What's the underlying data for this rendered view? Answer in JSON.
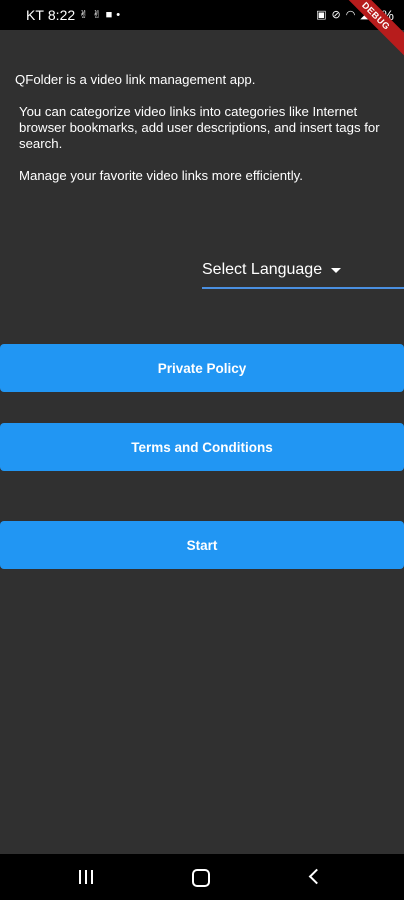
{
  "status_bar": {
    "carrier": "KT",
    "time": "8:22",
    "battery": "9%"
  },
  "debug_banner": "DEBUG",
  "intro": {
    "line1": "QFolder is a video link management app.",
    "line2": "You can categorize video links into categories like Internet browser bookmarks, add user descriptions, and insert tags for search.",
    "line3": "Manage your favorite video links more efficiently."
  },
  "language_dropdown": {
    "label": "Select Language"
  },
  "buttons": {
    "policy": "Private Policy",
    "terms": "Terms and Conditions",
    "start": "Start"
  },
  "colors": {
    "background": "#303030",
    "button": "#2196f3",
    "underline": "#4a8fe0",
    "debug": "#b71c1c"
  }
}
